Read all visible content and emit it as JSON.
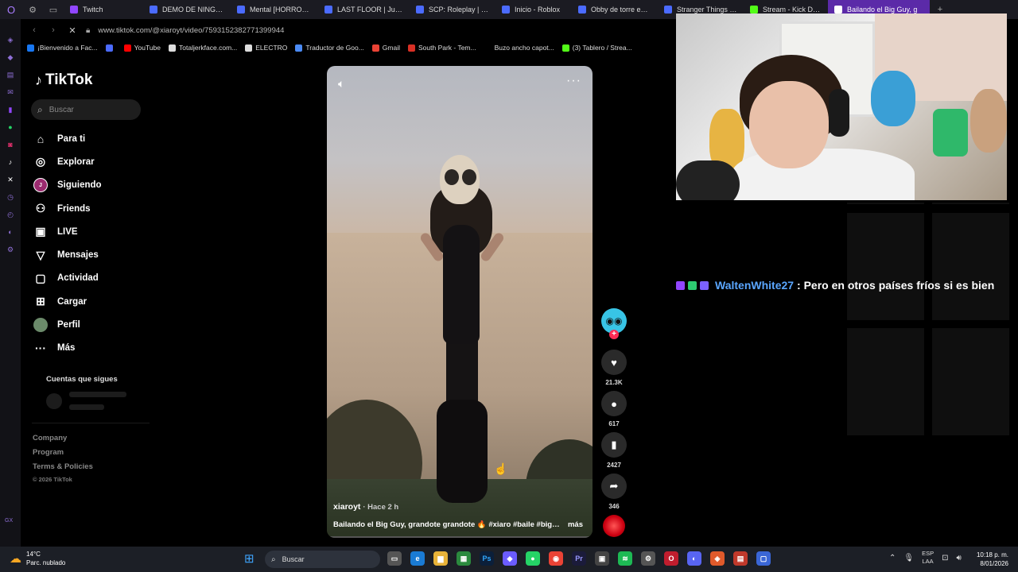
{
  "browser": {
    "tabs": [
      {
        "label": "Twitch",
        "color": "#9146ff"
      },
      {
        "label": "DEMO DE NINGUNO",
        "color": "#4b6bff"
      },
      {
        "label": "Mental [HORROR] - F",
        "color": "#4b6bff"
      },
      {
        "label": "LAST FLOOR | Juego",
        "color": "#4b6bff"
      },
      {
        "label": "SCP: Roleplay | El siti",
        "color": "#4b6bff"
      },
      {
        "label": "Inicio - Roblox",
        "color": "#4b6bff"
      },
      {
        "label": "Obby de torre espira",
        "color": "#4b6bff"
      },
      {
        "label": "Stranger Things [HO",
        "color": "#4b6bff"
      },
      {
        "label": "Stream - Kick Dashb",
        "color": "#53fc18"
      },
      {
        "label": "Bailando el Big Guy, g",
        "color": "#ffffff"
      }
    ],
    "url": "www.tiktok.com/@xiaroyt/video/7593152382771399944",
    "bookmarks": [
      {
        "label": "¡Bienvenido a Fac...",
        "color": "#1877f2"
      },
      {
        "label": "",
        "color": "#4b6bff"
      },
      {
        "label": "YouTube",
        "color": "#ff0000"
      },
      {
        "label": "Totaljerkface.com...",
        "color": "#dddddd"
      },
      {
        "label": "ELECTRO",
        "color": "#dddddd"
      },
      {
        "label": "Traductor de Goo...",
        "color": "#4b8bf5"
      },
      {
        "label": "Gmail",
        "color": "#ea4335"
      },
      {
        "label": "South Park - Tem...",
        "color": "#d93025"
      },
      {
        "label": "Buzo ancho capot...",
        "color": "#000000"
      },
      {
        "label": "(3) Tablero / Strea...",
        "color": "#53fc18"
      }
    ]
  },
  "tiktok": {
    "logo": "TikTok",
    "search_placeholder": "Buscar",
    "nav": [
      {
        "label": "Para ti",
        "icon": "⌂",
        "name": "home-icon"
      },
      {
        "label": "Explorar",
        "icon": "◎",
        "name": "compass-icon"
      },
      {
        "label": "Siguiendo",
        "icon": "J",
        "name": "following-avatar-icon"
      },
      {
        "label": "Friends",
        "icon": "⚇",
        "name": "friends-icon"
      },
      {
        "label": "LIVE",
        "icon": "▣",
        "name": "live-icon"
      },
      {
        "label": "Mensajes",
        "icon": "▽",
        "name": "messages-icon"
      },
      {
        "label": "Actividad",
        "icon": "▢",
        "name": "activity-icon"
      },
      {
        "label": "Cargar",
        "icon": "⊞",
        "name": "upload-icon"
      },
      {
        "label": "Perfil",
        "icon": "",
        "name": "profile-avatar-icon"
      },
      {
        "label": "Más",
        "icon": "···",
        "name": "more-icon"
      }
    ],
    "following_title": "Cuentas que sigues",
    "footer": [
      "Company",
      "Program",
      "Terms & Policies"
    ],
    "copyright": "© 2026 TikTok",
    "video": {
      "author": "xiaroyt",
      "time": "· Hace 2 h",
      "description": "Bailando el Big Guy, grandote grandote 🔥 #xiaro #baile #biggu...",
      "more": "más",
      "likes": "21.3K",
      "comments": "617",
      "saves": "2427",
      "shares": "346"
    }
  },
  "chat": {
    "username": "WaltenWhite27",
    "message": ": Pero en otros países fríos si es bien",
    "badge_colors": [
      "#9146ff",
      "#2ecc71",
      "#7b61ff"
    ]
  },
  "taskbar": {
    "weather_temp": "14°C",
    "weather_desc": "Parc. nublado",
    "search_placeholder": "Buscar",
    "lang_top": "ESP",
    "lang_bottom": "LAA",
    "time": "10:18 p. m.",
    "date": "8/01/2026"
  }
}
